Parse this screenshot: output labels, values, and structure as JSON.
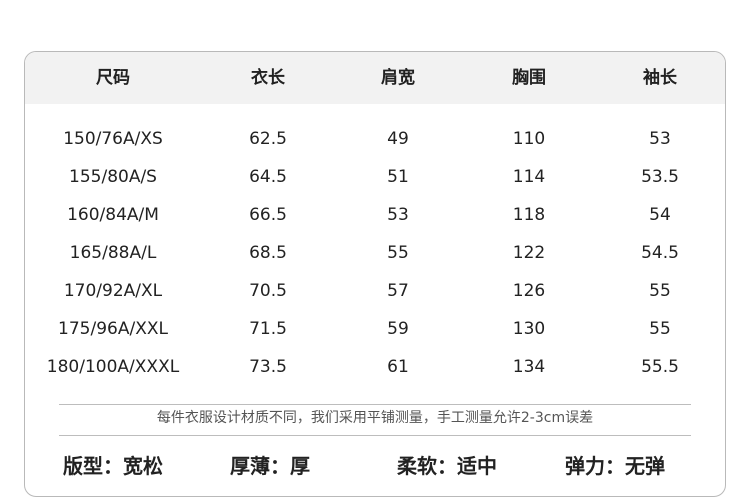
{
  "headers": [
    "尺码",
    "衣长",
    "肩宽",
    "胸围",
    "袖长"
  ],
  "rows": [
    [
      "150/76A/XS",
      "62.5",
      "49",
      "110",
      "53"
    ],
    [
      "155/80A/S",
      "64.5",
      "51",
      "114",
      "53.5"
    ],
    [
      "160/84A/M",
      "66.5",
      "53",
      "118",
      "54"
    ],
    [
      "165/88A/L",
      "68.5",
      "55",
      "122",
      "54.5"
    ],
    [
      "170/92A/XL",
      "70.5",
      "57",
      "126",
      "55"
    ],
    [
      "175/96A/XXL",
      "71.5",
      "59",
      "130",
      "55"
    ],
    [
      "180/100A/XXXL",
      "73.5",
      "61",
      "134",
      "55.5"
    ]
  ],
  "note": "每件衣服设计材质不同，我们采用平铺测量，手工测量允许2-3cm误差",
  "attributes": [
    "版型：宽松",
    "厚薄：厚",
    "柔软：适中",
    "弹力：无弹"
  ]
}
